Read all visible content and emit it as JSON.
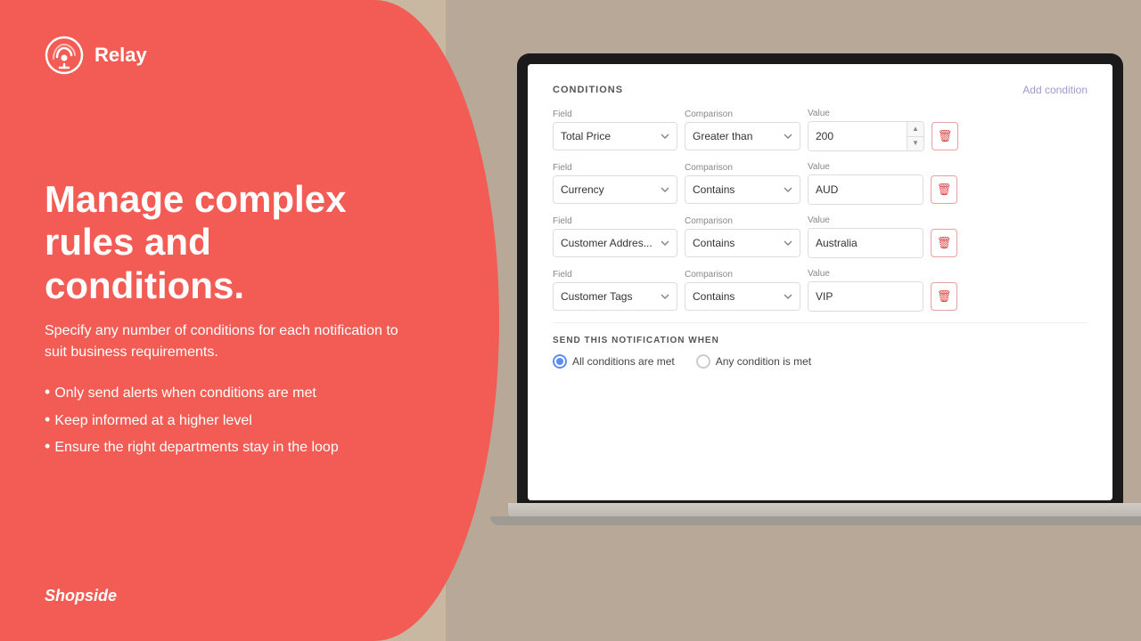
{
  "logo": {
    "name": "Relay",
    "icon": "bell"
  },
  "headline": "Manage complex rules and conditions.",
  "subtitle": "Specify any number of conditions for each notification to suit business requirements.",
  "bullets": [
    "Only send alerts when conditions are met",
    "Keep informed at a higher level",
    "Ensure the right departments stay in the loop"
  ],
  "shopside": "Shopside",
  "panel": {
    "title": "CONDITIONS",
    "add_button": "Add condition",
    "conditions": [
      {
        "field_label": "Field",
        "field_value": "Total Price",
        "comparison_label": "Comparison",
        "comparison_value": "Greater than",
        "value_label": "Value",
        "value": "200",
        "has_spinners": true
      },
      {
        "field_label": "Field",
        "field_value": "Currency",
        "comparison_label": "Comparison",
        "comparison_value": "Contains",
        "value_label": "Value",
        "value": "AUD",
        "has_spinners": false
      },
      {
        "field_label": "Field",
        "field_value": "Customer Addres...",
        "comparison_label": "Comparison",
        "comparison_value": "Contains",
        "value_label": "Value",
        "value": "Australia",
        "has_spinners": false
      },
      {
        "field_label": "Field",
        "field_value": "Customer Tags",
        "comparison_label": "Comparison",
        "comparison_value": "Contains",
        "value_label": "Value",
        "value": "VIP",
        "has_spinners": false
      }
    ],
    "send_section": {
      "label": "SEND THIS NOTIFICATION WHEN",
      "options": [
        {
          "label": "All conditions are met",
          "selected": true
        },
        {
          "label": "Any condition is met",
          "selected": false
        }
      ]
    }
  }
}
